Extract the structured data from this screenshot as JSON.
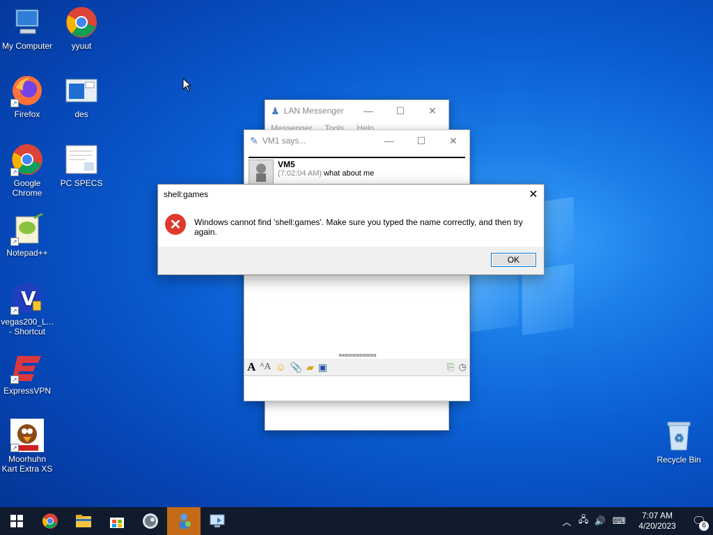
{
  "desktop": {
    "icons": [
      {
        "label": "My Computer"
      },
      {
        "label": "yyuut"
      },
      {
        "label": "Firefox"
      },
      {
        "label": "des"
      },
      {
        "label": "Google Chrome"
      },
      {
        "label": "PC SPECS"
      },
      {
        "label": "Notepad++"
      },
      {
        "label": "vegas200_L... - Shortcut"
      },
      {
        "label": "ExpressVPN"
      },
      {
        "label": "Moorhuhn Kart Extra XS"
      },
      {
        "label": "Recycle Bin"
      }
    ]
  },
  "lan_messenger": {
    "title": "LAN Messenger",
    "menu": [
      "Messenger",
      "Tools",
      "Help"
    ]
  },
  "chat": {
    "title": "VM1 says...",
    "sender": "VM5",
    "time": "(7:02:04 AM)",
    "message": "what about me"
  },
  "dialog": {
    "title": "shell:games",
    "message": "Windows cannot find 'shell:games'. Make sure you typed the name correctly, and then try again.",
    "ok_label": "OK"
  },
  "taskbar": {
    "time": "7:07 AM",
    "date": "4/20/2023",
    "notification_count": "6"
  },
  "colors": {
    "accent": "#0078d7",
    "error": "#e03a2f",
    "taskbar_active": "#c56a16"
  }
}
